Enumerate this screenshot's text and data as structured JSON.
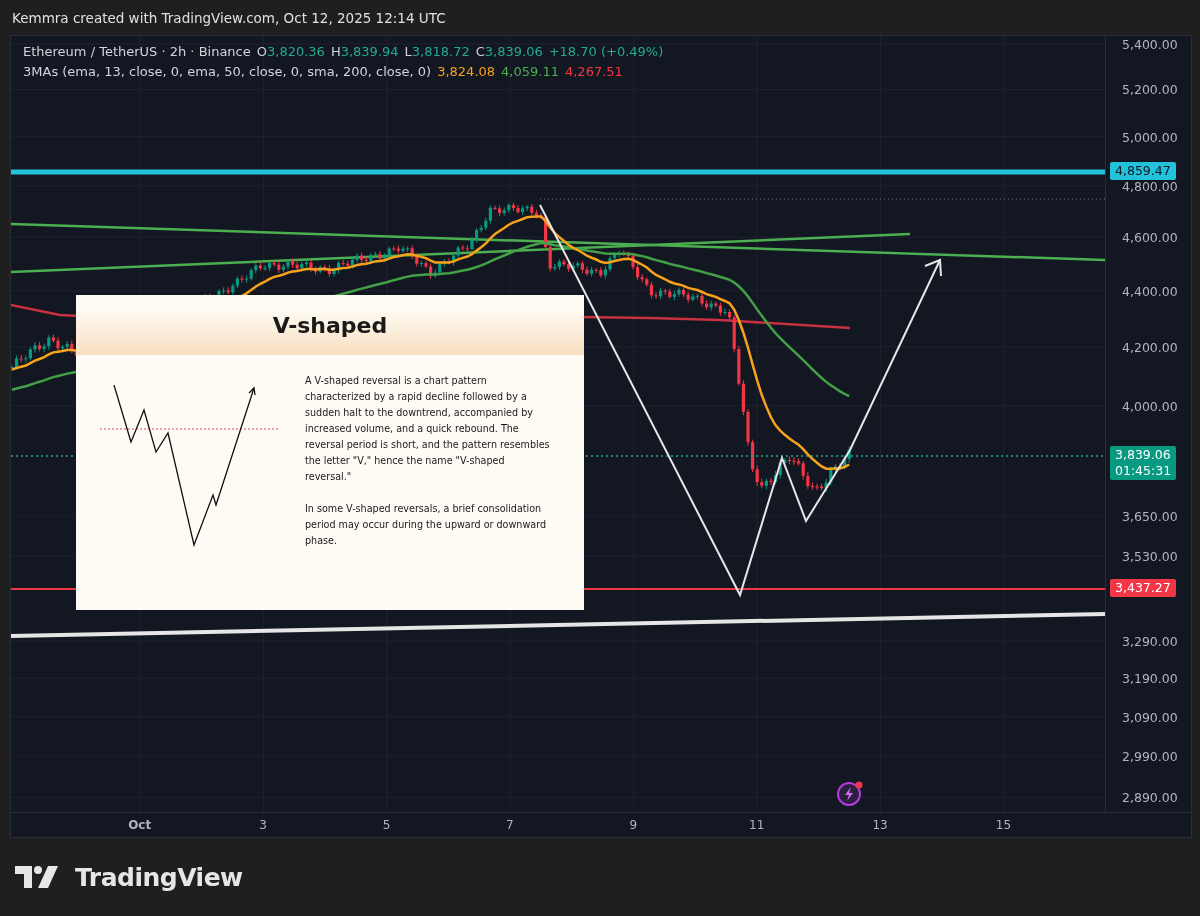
{
  "header": {
    "attribution": "Kemmra created with TradingView.com, Oct 12, 2025 12:14 UTC"
  },
  "legend": {
    "symbol": "Ethereum / TetherUS · 2h · Binance",
    "ohlc": [
      {
        "label": "O",
        "value": "3,820.36"
      },
      {
        "label": "H",
        "value": "3,839.94"
      },
      {
        "label": "L",
        "value": "3,818.72"
      },
      {
        "label": "C",
        "value": "3,839.06"
      }
    ],
    "change": "+18.70 (+0.49%)"
  },
  "indicator": {
    "name": "3MAs (ema, 13, close, 0, ema, 50, close, 0, sma, 200, close, 0)",
    "values": [
      {
        "value": "3,824.08",
        "color": "#f7a21b"
      },
      {
        "value": "4,059.11",
        "color": "#4caf50"
      },
      {
        "value": "4,267.51",
        "color": "#f23645"
      }
    ]
  },
  "info_card": {
    "title": "V-shaped",
    "paragraphs": [
      "A V-shaped reversal is a chart pattern characterized by a rapid decline followed by a sudden halt to the downtrend, accompanied by increased volume, and a quick rebound. The reversal period is short, and the pattern resembles the letter \"V,\" hence the name \"V-shaped reversal.\"",
      "In some V-shaped reversals, a brief consolidation period may occur during the upward or downward phase."
    ]
  },
  "price_axis": {
    "labels": [
      "5,400.00",
      "5,200.00",
      "5,000.00",
      "4,800.00",
      "4,600.00",
      "4,400.00",
      "4,200.00",
      "4,000.00",
      "3,650.00",
      "3,530.00",
      "3,290.00",
      "3,190.00",
      "3,090.00",
      "2,990.00",
      "2,890.00"
    ],
    "tags": [
      {
        "value": "4,859.47",
        "color": "#22c1dc"
      },
      {
        "value": "3,839.06",
        "color": "#089981",
        "countdown": "01:45:31"
      },
      {
        "value": "3,437.27",
        "color": "#f23645"
      }
    ]
  },
  "time_axis": {
    "labels": [
      {
        "text": "Oct",
        "kind": "month"
      },
      {
        "text": "3",
        "kind": "day"
      },
      {
        "text": "5",
        "kind": "day"
      },
      {
        "text": "7",
        "kind": "day"
      },
      {
        "text": "9",
        "kind": "day"
      },
      {
        "text": "11",
        "kind": "day"
      },
      {
        "text": "13",
        "kind": "day"
      },
      {
        "text": "15",
        "kind": "day"
      }
    ]
  },
  "footer": {
    "logo_text": "TradingView"
  }
}
